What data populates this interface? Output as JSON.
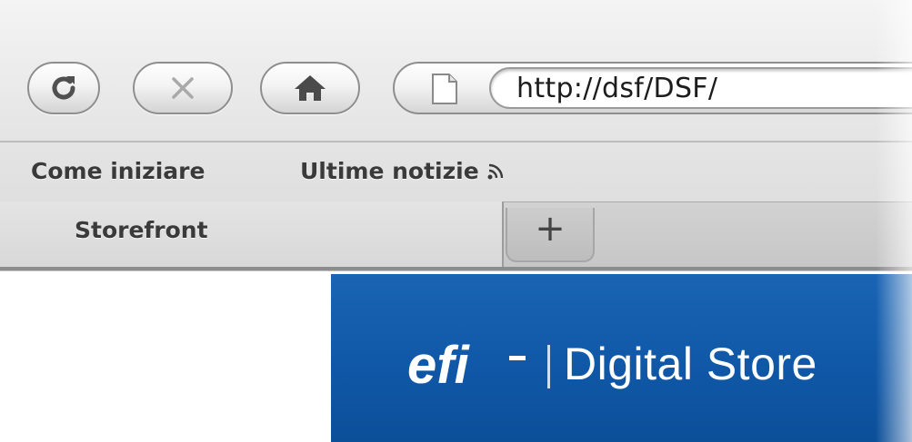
{
  "toolbar": {
    "reload_icon": "reload-icon",
    "stop_icon": "close-icon",
    "home_icon": "home-icon",
    "page_icon": "page-icon",
    "url": "http://dsf/DSF/"
  },
  "bookmarks": {
    "items": [
      {
        "label": "Come iniziare"
      },
      {
        "label": "Ultime notizie",
        "icon": "rss-icon"
      }
    ]
  },
  "tabs": {
    "active_label": "Storefront",
    "new_tab_symbol": "+"
  },
  "page": {
    "logo_text": "efi",
    "brand_title": "Digital Store",
    "header_color": "#1a64b4"
  }
}
